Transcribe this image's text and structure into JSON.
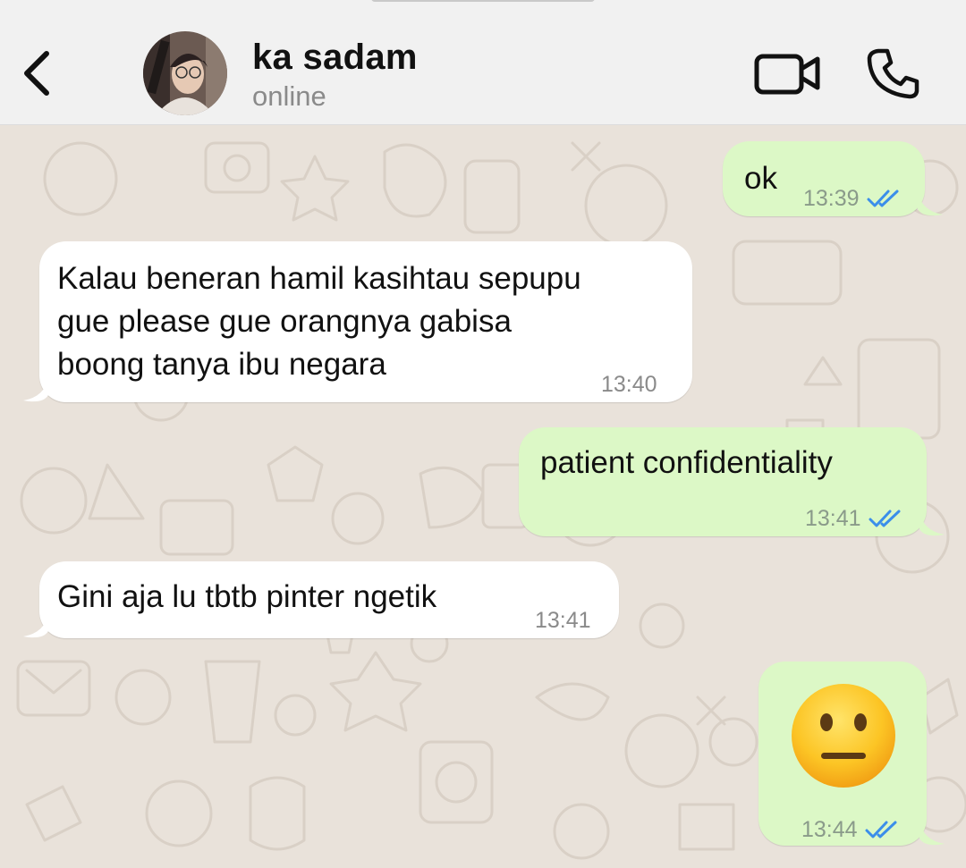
{
  "header": {
    "contact_name": "ka sadam",
    "status": "online",
    "back_icon": "chevron-left-icon",
    "video_icon": "video-camera-icon",
    "call_icon": "phone-icon"
  },
  "colors": {
    "outgoing_bubble": "#dcf8c6",
    "incoming_bubble": "#ffffff",
    "read_ticks": "#3b8eea",
    "wallpaper": "#e9e2da"
  },
  "messages": [
    {
      "direction": "outgoing",
      "text": "ok",
      "time": "13:39",
      "status": "read"
    },
    {
      "direction": "incoming",
      "lines": [
        "Kalau beneran hamil kasihtau sepupu",
        "gue please gue orangnya gabisa",
        "boong tanya ibu negara"
      ],
      "time": "13:40"
    },
    {
      "direction": "outgoing",
      "text": "patient confidentiality",
      "time": "13:41",
      "status": "read"
    },
    {
      "direction": "incoming",
      "text": "Gini aja lu tbtb pinter ngetik",
      "time": "13:41"
    },
    {
      "direction": "outgoing",
      "emoji": "neutral-face",
      "time": "13:44",
      "status": "read"
    }
  ]
}
